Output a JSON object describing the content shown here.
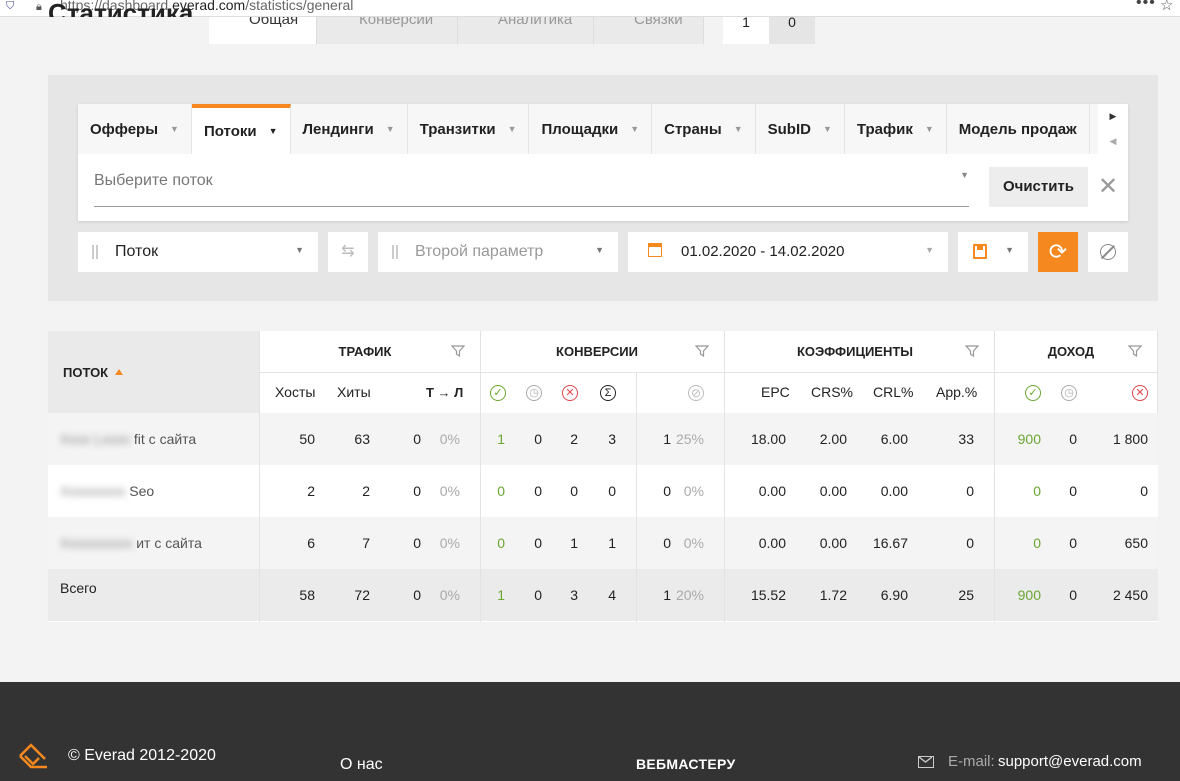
{
  "browser": {
    "url_prefix": "https://dashboard.",
    "url_domain": "everad.com",
    "url_path": "/statistics/general",
    "more_label": "•••",
    "star_label": "☆"
  },
  "header": {
    "title": "Статистика",
    "tabs": [
      {
        "label": "Общая"
      },
      {
        "label": "Конверсии"
      },
      {
        "label": "Аналитика"
      },
      {
        "label": "Связки"
      }
    ],
    "pager": [
      "1",
      "0"
    ]
  },
  "filter": {
    "tabs": [
      {
        "label": "Офферы",
        "active": false
      },
      {
        "label": "Потоки",
        "active": true
      },
      {
        "label": "Лендинги",
        "active": false
      },
      {
        "label": "Транзитки",
        "active": false
      },
      {
        "label": "Площадки",
        "active": false
      },
      {
        "label": "Страны",
        "active": false
      },
      {
        "label": "SubID",
        "active": false
      },
      {
        "label": "Трафик",
        "active": false
      },
      {
        "label": "Модель продаж",
        "active": false
      }
    ],
    "nav_next": "▶",
    "nav_prev": "◀",
    "stream_placeholder": "Выберите поток",
    "clear_label": "Очистить",
    "close_label": "✕"
  },
  "controls": {
    "param1": "Поток",
    "param2_placeholder": "Второй параметр",
    "date_range": "01.02.2020 - 14.02.2020",
    "swap_icon": "⇆",
    "refresh_icon": "⟳"
  },
  "table": {
    "stream_header": "ПОТОК",
    "groups": {
      "traffic": "ТРАФИК",
      "conversions": "КОНВЕРСИИ",
      "coefficients": "КОЭФФИЦИЕНТЫ",
      "income": "ДОХОД"
    },
    "subheaders": {
      "hosts": "Хосты",
      "hits": "Хиты",
      "t_l": "Т → Л",
      "epc": "EPC",
      "crs": "CRS%",
      "crl": "CRL%",
      "app": "App.%"
    },
    "rows": [
      {
        "name_hidden": "Xxxx Lxxxx",
        "name": "fit с сайта",
        "hosts": "50",
        "hits": "63",
        "tl": "0",
        "tl_pct": "0%",
        "c_ok": "1",
        "c_wait": "0",
        "c_rej": "2",
        "c_sum": "3",
        "c_trash": "1",
        "c_trash_pct": "25%",
        "epc": "18.00",
        "crs": "2.00",
        "crl": "6.00",
        "app": "33",
        "i_ok": "900",
        "i_wait": "0",
        "i_rej": "1 800"
      },
      {
        "name_hidden": "Xxxxxxxxx",
        "name": "Seo",
        "hosts": "2",
        "hits": "2",
        "tl": "0",
        "tl_pct": "0%",
        "c_ok": "0",
        "c_wait": "0",
        "c_rej": "0",
        "c_sum": "0",
        "c_trash": "0",
        "c_trash_pct": "0%",
        "epc": "0.00",
        "crs": "0.00",
        "crl": "0.00",
        "app": "0",
        "i_ok": "0",
        "i_wait": "0",
        "i_rej": "0"
      },
      {
        "name_hidden": "Xxxxxxxxxx",
        "name": "ит с сайта",
        "hosts": "6",
        "hits": "7",
        "tl": "0",
        "tl_pct": "0%",
        "c_ok": "0",
        "c_wait": "0",
        "c_rej": "1",
        "c_sum": "1",
        "c_trash": "0",
        "c_trash_pct": "0%",
        "epc": "0.00",
        "crs": "0.00",
        "crl": "16.67",
        "app": "0",
        "i_ok": "0",
        "i_wait": "0",
        "i_rej": "650"
      }
    ],
    "total": {
      "name": "Всего",
      "hosts": "58",
      "hits": "72",
      "tl": "0",
      "tl_pct": "0%",
      "c_ok": "1",
      "c_wait": "0",
      "c_rej": "3",
      "c_sum": "4",
      "c_trash": "1",
      "c_trash_pct": "20%",
      "epc": "15.52",
      "crs": "1.72",
      "crl": "6.90",
      "app": "25",
      "i_ok": "900",
      "i_wait": "0",
      "i_rej": "2 450"
    }
  },
  "footer": {
    "copyright": "© Everad 2012-2020",
    "about": "О нас",
    "webmaster": "ВЕБМАСТЕРУ",
    "email_label": "E-mail:",
    "email": "support@everad.com"
  },
  "colors": {
    "accent": "#f5891f",
    "positive": "#6aa632",
    "negative": "#e0454a",
    "footer_bg": "#333333"
  }
}
